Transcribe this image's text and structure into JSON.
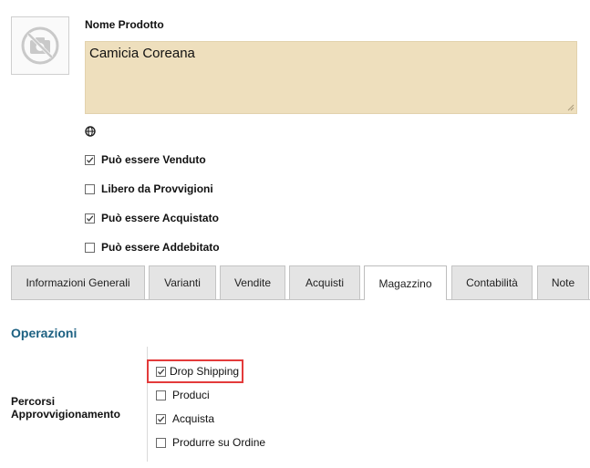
{
  "product": {
    "name_label": "Nome Prodotto",
    "name_value": "Camicia Coreana",
    "image_icon": "no-camera-icon",
    "language_icon": "globe-icon"
  },
  "flags": [
    {
      "label": "Può essere Venduto",
      "checked": true
    },
    {
      "label": "Libero da Provvigioni",
      "checked": false
    },
    {
      "label": "Può essere Acquistato",
      "checked": true
    },
    {
      "label": "Può essere Addebitato",
      "checked": false
    }
  ],
  "tabs": [
    {
      "label": "Informazioni Generali",
      "active": false
    },
    {
      "label": "Varianti",
      "active": false
    },
    {
      "label": "Vendite",
      "active": false
    },
    {
      "label": "Acquisti",
      "active": false
    },
    {
      "label": "Magazzino",
      "active": true
    },
    {
      "label": "Contabilità",
      "active": false
    },
    {
      "label": "Note",
      "active": false
    }
  ],
  "operations": {
    "section_title": "Operazioni",
    "routes_label": "Percorsi Approvvigionamento",
    "routes": [
      {
        "label": "Drop Shipping",
        "checked": true,
        "highlighted": true
      },
      {
        "label": "Produci",
        "checked": false
      },
      {
        "label": "Acquista",
        "checked": true
      },
      {
        "label": "Produrre su Ordine",
        "checked": false
      }
    ]
  },
  "colors": {
    "name_field_bg": "#eedfbd",
    "section_title": "#1d6182",
    "highlight_border": "#e33b3b",
    "tab_bg": "#e4e4e4",
    "tab_active_bg": "#ffffff"
  }
}
